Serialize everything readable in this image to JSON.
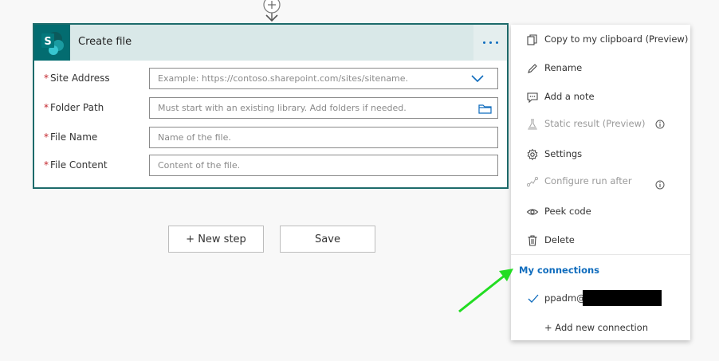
{
  "card": {
    "title": "Create file",
    "icon_letter": "S",
    "fields": [
      {
        "label": "Site Address",
        "placeholder": "Example: https://contoso.sharepoint.com/sites/sitename.",
        "icon": "chevron-down-icon"
      },
      {
        "label": "Folder Path",
        "placeholder": "Must start with an existing library. Add folders if needed.",
        "icon": "folder-icon"
      },
      {
        "label": "File Name",
        "placeholder": "Name of the file."
      },
      {
        "label": "File Content",
        "placeholder": "Content of the file."
      }
    ]
  },
  "buttons": {
    "new_step": "+ New step",
    "save": "Save"
  },
  "menu": {
    "items": [
      {
        "label": "Copy to my clipboard (Preview)",
        "icon": "copy-icon",
        "enabled": true
      },
      {
        "label": "Rename",
        "icon": "pencil-icon",
        "enabled": true
      },
      {
        "label": "Add a note",
        "icon": "comment-icon",
        "enabled": true
      },
      {
        "label": "Static result (Preview)",
        "icon": "flask-icon",
        "enabled": false
      },
      {
        "label": "Settings",
        "icon": "gear-icon",
        "enabled": true
      },
      {
        "label": "Configure run after",
        "icon": "run-after-icon",
        "enabled": false
      },
      {
        "label": "Peek code",
        "icon": "eye-icon",
        "enabled": true
      },
      {
        "label": "Delete",
        "icon": "trash-icon",
        "enabled": true
      }
    ],
    "connections_title": "My connections",
    "connection_user": "ppadm@",
    "add_connection": "+ Add new connection"
  },
  "colors": {
    "accent": "#0f6cbd",
    "card_border": "#1d6b6b",
    "header_bg": "#d9e8e8",
    "sharepoint": "#036c70",
    "required": "#c4262e",
    "annotation_arrow": "#22dd22"
  }
}
